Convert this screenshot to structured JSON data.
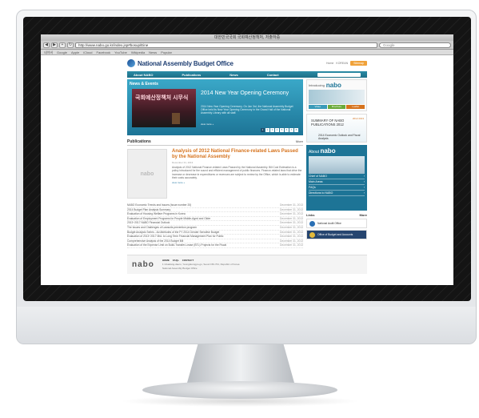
{
  "browser": {
    "title": "대한민국국회 국회예산정책처, 저출하중",
    "url": "http://www.nabo.go.kr/index.jsp#bosup/Eine",
    "search_placeholder": "Google",
    "bookmarks": [
      "네이버",
      "Google",
      "Apple",
      "iCloud",
      "Facebook",
      "YouTube",
      "Wikipedia",
      "News",
      "Popular"
    ],
    "nav_buttons": [
      "◀",
      "▶",
      "+",
      "↻"
    ]
  },
  "site": {
    "logo_text": "National Assembly Budget Office",
    "header_links": [
      "Home",
      "KOREAN"
    ],
    "header_button": "Sitemap",
    "nav": [
      "About NABO",
      "Publications",
      "News",
      "Contact"
    ],
    "news": {
      "section_title": "News & Events",
      "photo_text": "국회예산정책처 시무식",
      "headline": "2014 New Year Opening Ceremony",
      "body": "2014 New Year Opening Ceremony. On Jan 3rd, the National Assembly Budget Office held its New Year Opening Ceremony in the Grand Hall of the National Assembly Library with all staff.",
      "more": "view more +",
      "pages": [
        "1",
        "2",
        "3",
        "4",
        "5",
        "6",
        "7",
        "8"
      ],
      "active_page": "1"
    },
    "publications": {
      "title": "Publications",
      "more": "More",
      "thumb_text": "nabo",
      "feature_title": "Analysis of 2012 National Finance-related Laws Passed by the National Assembly",
      "feature_date": "December 31, 2013",
      "feature_body": "Analysis of 2012 National Finance-related Laws Passed by the National Assembly. Bill Cost Estimation is a policy introduced for the sound and efficient management of public finances. Finance-related laws that drive the increase or decrease in expenditures or revenues are subject to review by the Office, which is able to estimate their costs accurately.",
      "feature_more": "view more +",
      "list": [
        {
          "title": "NABO Economic Trends and Issues (Issue number 20)",
          "date": "December 31, 2013"
        },
        {
          "title": "2014 Budget Plan Analysis Summary",
          "date": "December 31, 2013"
        },
        {
          "title": "Evaluation of Housing Welfare Programs in Korea",
          "date": "December 31, 2013"
        },
        {
          "title": "Evaluation of Employment Programs for People Middle-Aged and Older",
          "date": "December 31, 2013"
        },
        {
          "title": "2013~2017 NABO Financial Outlook",
          "date": "December 31, 2013"
        },
        {
          "title": "The Issues and Challenges of Lawsuits prevention program",
          "date": "December 31, 2013"
        },
        {
          "title": "Budget Analysis Series - Ad Attributes of the FY 2014 Gender Sensitive Budget",
          "date": "December 31, 2013"
        },
        {
          "title": "Evaluation of 2013~2017 Mid- to Long Term Financial Management Plan for Public",
          "date": "December 31, 2013"
        },
        {
          "title": "Comprehensive Analysis of the 2014 Budget Bill",
          "date": "December 31, 2013"
        },
        {
          "title": "Evaluation of the Expense Limit on Build-Transfer-Lease (BTL) Projects for the Fiscal",
          "date": "December 31, 2013"
        }
      ]
    },
    "sidebar": {
      "intro_label": "Introducing",
      "intro_brand": "nabo",
      "intro_tabs": [
        "Video",
        "Brochure",
        "Leaflet"
      ],
      "summary_title": "SUMMARY OF NABO PUBLICATIONS 2012",
      "summary_tag": "2012 2013",
      "summary_sub": "2014 Economic Outlook and Fiscal Analysis",
      "about_label": "About",
      "about_brand": "nabo",
      "about_links": [
        "Chief of NABO",
        "Main Areas",
        "FAQs",
        "Directions to NABO"
      ],
      "links_title": "Links",
      "links_more": "More",
      "banners": [
        "National Audit Office",
        "Office of Budget and Accounts"
      ]
    },
    "footer": {
      "logo": "nabo",
      "links": [
        "HOME",
        "FAQs",
        "CONTACT"
      ],
      "address": "1 Uisadang-daero, Yeongdeungpo-gu, Seoul 150-701, Republic of Korea",
      "copyright": "National Assembly Budget Office"
    }
  }
}
